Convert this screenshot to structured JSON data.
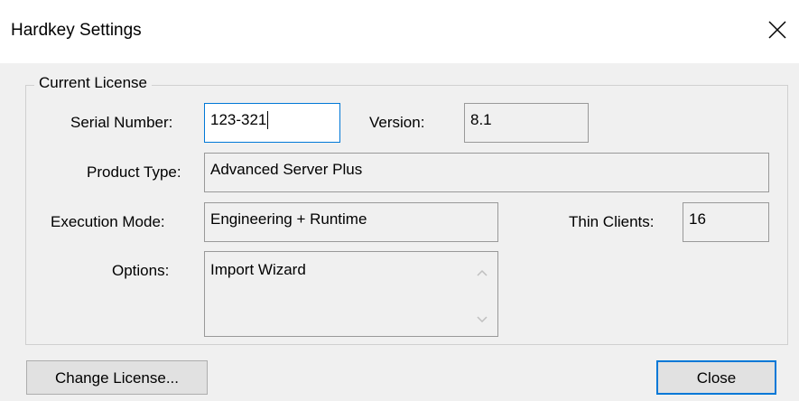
{
  "window": {
    "title": "Hardkey Settings",
    "close_icon": "close-icon"
  },
  "license_group": {
    "legend": "Current License",
    "serial_number": {
      "label": "Serial Number:",
      "value": "123-321"
    },
    "version": {
      "label": "Version:",
      "value": "8.1"
    },
    "product_type": {
      "label": "Product Type:",
      "value": "Advanced Server Plus"
    },
    "execution_mode": {
      "label": "Execution Mode:",
      "value": "Engineering + Runtime"
    },
    "thin_clients": {
      "label": "Thin Clients:",
      "value": "16"
    },
    "options": {
      "label": "Options:",
      "items": [
        "Import Wizard"
      ],
      "scroll_up_icon": "chevron-up-icon",
      "scroll_down_icon": "chevron-down-icon"
    }
  },
  "buttons": {
    "change_license": "Change License...",
    "close": "Close"
  },
  "colors": {
    "focus_border": "#0078d7",
    "dialog_bg": "#f0f0f0",
    "titlebar_bg": "#ffffff"
  }
}
